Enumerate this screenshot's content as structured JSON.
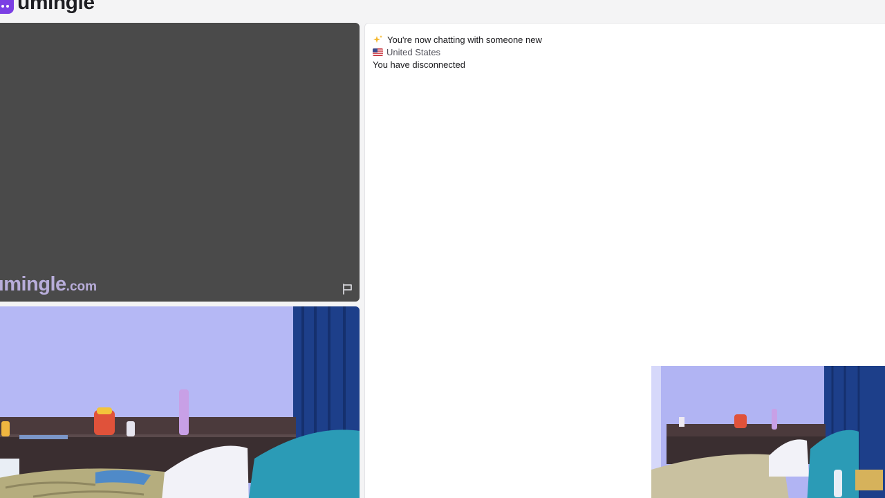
{
  "header": {
    "logo_text": "umingle",
    "logo_icon": "chat-bubble-icon",
    "brand_color": "#7b3fe4"
  },
  "stranger_video": {
    "watermark_main": "umingle",
    "watermark_tld": ".com",
    "report_icon": "flag-icon",
    "background_color": "#4a4a4a"
  },
  "chat": {
    "messages": [
      {
        "icon": "sparkles-icon",
        "text": "You're now chatting with someone new"
      },
      {
        "icon": "us-flag-icon",
        "text": "United States"
      },
      {
        "icon": "",
        "text": "You have disconnected"
      }
    ]
  },
  "self_video": {
    "description_icon": "webcam-feed"
  }
}
